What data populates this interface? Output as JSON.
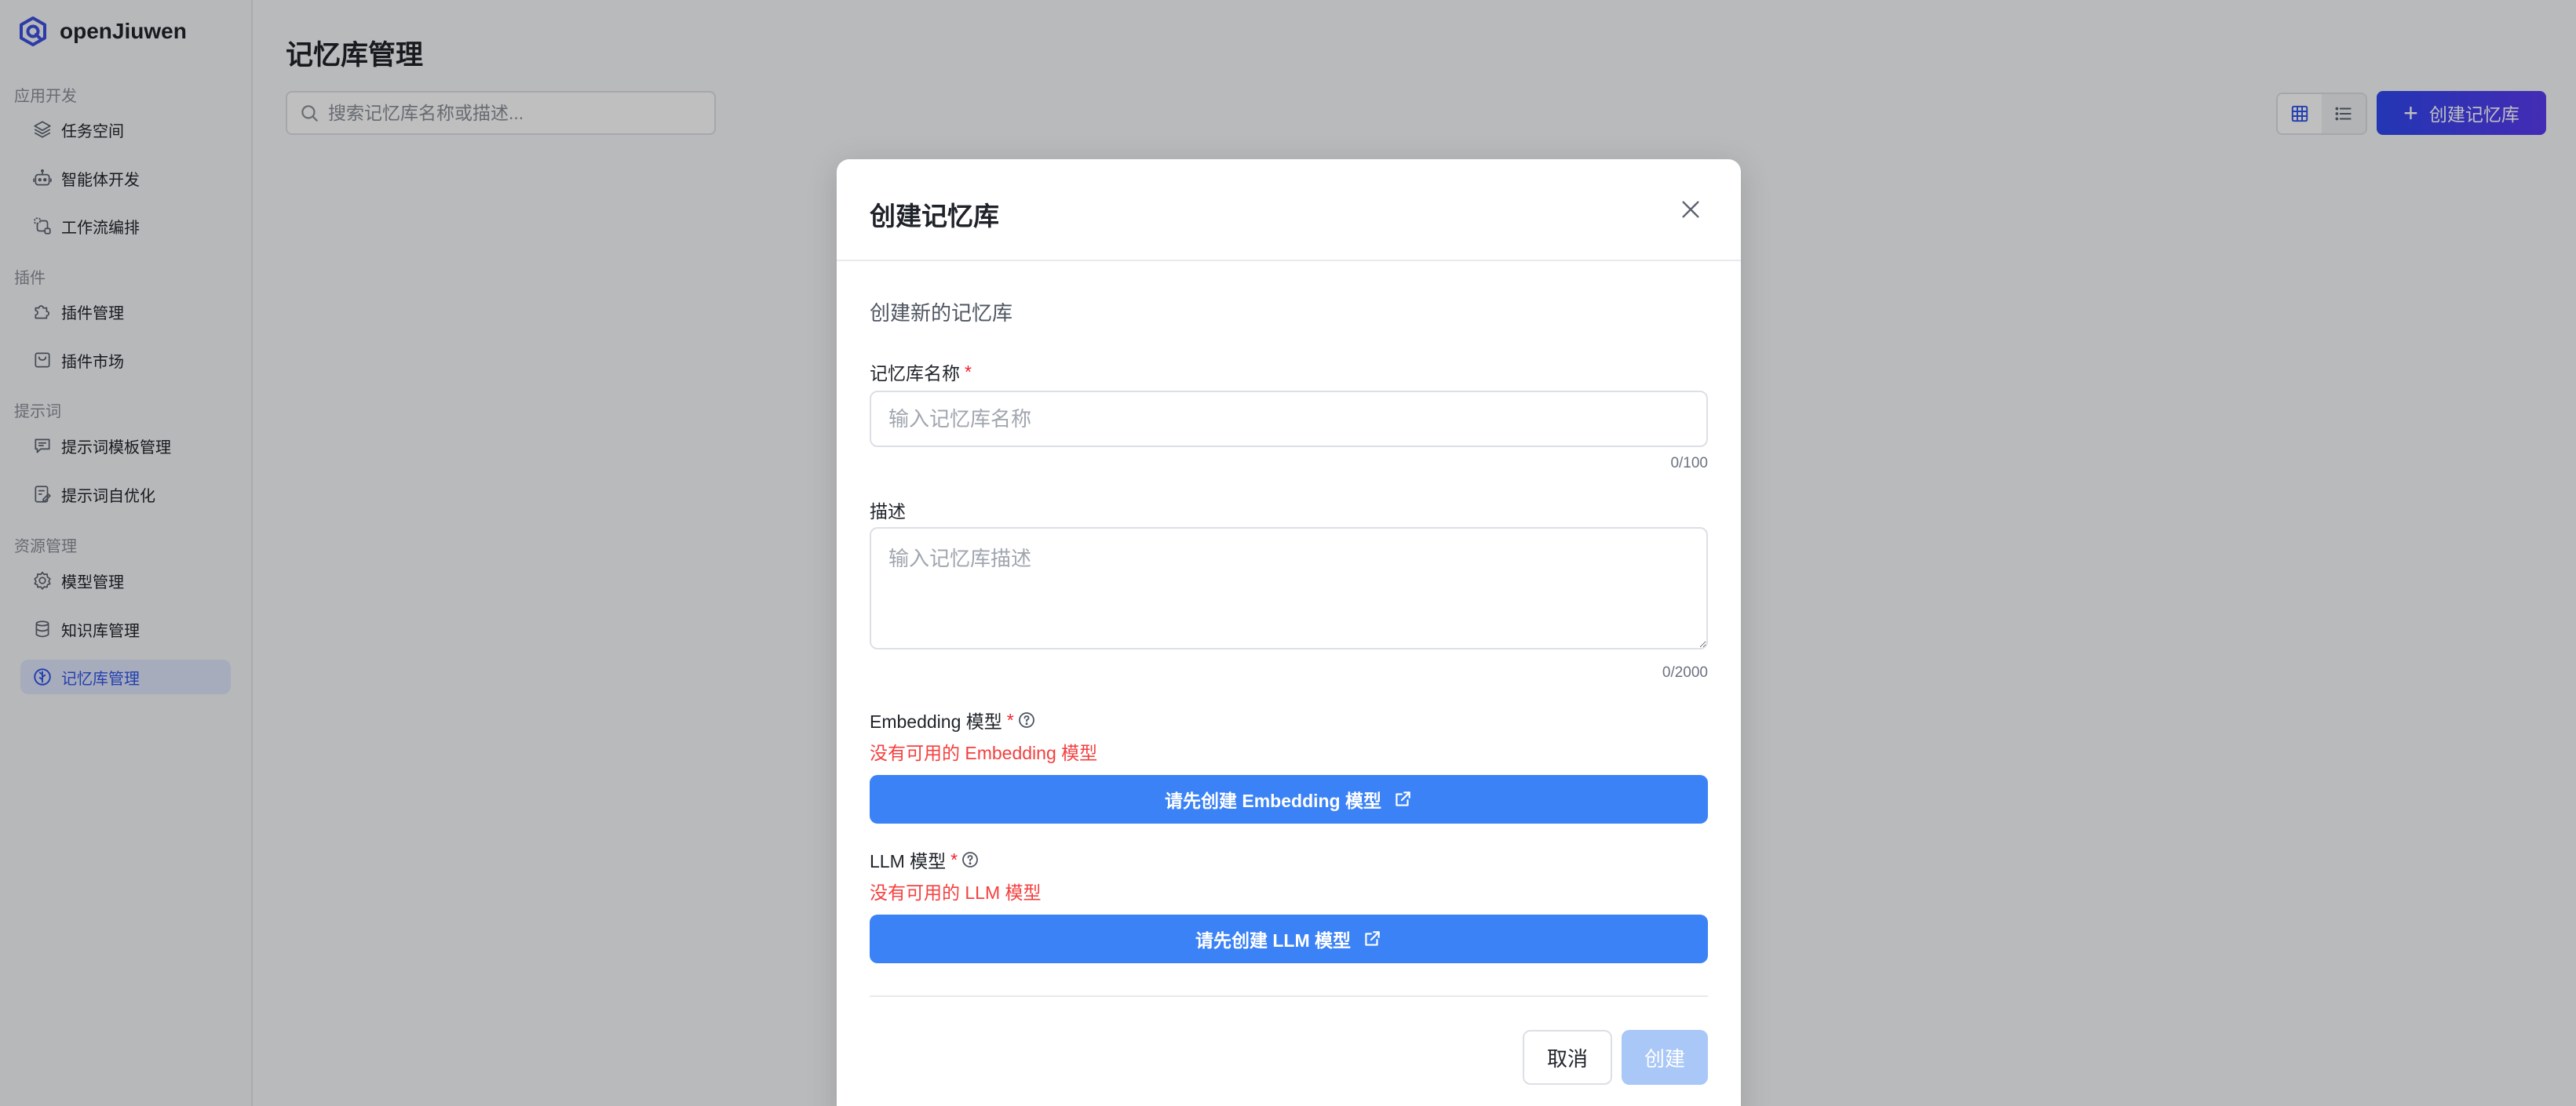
{
  "app": {
    "name": "openJiuwen",
    "logo_icon": "logo-icon"
  },
  "sidebar": {
    "sections": [
      {
        "label": "应用开发",
        "items": [
          {
            "label": "任务空间",
            "icon": "layers-icon"
          },
          {
            "label": "智能体开发",
            "icon": "robot-icon"
          },
          {
            "label": "工作流编排",
            "icon": "workflow-icon"
          }
        ]
      },
      {
        "label": "插件",
        "items": [
          {
            "label": "插件管理",
            "icon": "puzzle-icon"
          },
          {
            "label": "插件市场",
            "icon": "shopping-bag-icon"
          }
        ]
      },
      {
        "label": "提示词",
        "items": [
          {
            "label": "提示词模板管理",
            "icon": "chat-icon"
          },
          {
            "label": "提示词自优化",
            "icon": "document-edit-icon"
          }
        ]
      },
      {
        "label": "资源管理",
        "items": [
          {
            "label": "模型管理",
            "icon": "model-gear-icon"
          },
          {
            "label": "知识库管理",
            "icon": "database-icon"
          },
          {
            "label": "记忆库管理",
            "icon": "memory-icon",
            "active": true
          }
        ]
      }
    ]
  },
  "main": {
    "title": "记忆库管理",
    "search_placeholder": "搜索记忆库名称或描述...",
    "create_button": "创建记忆库",
    "view_modes": [
      "grid",
      "list"
    ],
    "active_view": "grid"
  },
  "modal": {
    "title": "创建记忆库",
    "subtitle": "创建新的记忆库",
    "name": {
      "label": "记忆库名称",
      "required_mark": "*",
      "placeholder": "输入记忆库名称",
      "counter": "0/100"
    },
    "description": {
      "label": "描述",
      "placeholder": "输入记忆库描述",
      "counter": "0/2000"
    },
    "embedding": {
      "label": "Embedding 模型",
      "required_mark": "*",
      "error": "没有可用的 Embedding 模型",
      "button": "请先创建 Embedding 模型"
    },
    "llm": {
      "label": "LLM 模型",
      "required_mark": "*",
      "error": "没有可用的 LLM 模型",
      "button": "请先创建 LLM 模型"
    },
    "cancel": "取消",
    "create": "创建"
  },
  "colors": {
    "accent": "#3b82f6",
    "brand": "#2f48f0",
    "error": "#f53f3f",
    "active_nav_bg": "#dfe6fb"
  }
}
